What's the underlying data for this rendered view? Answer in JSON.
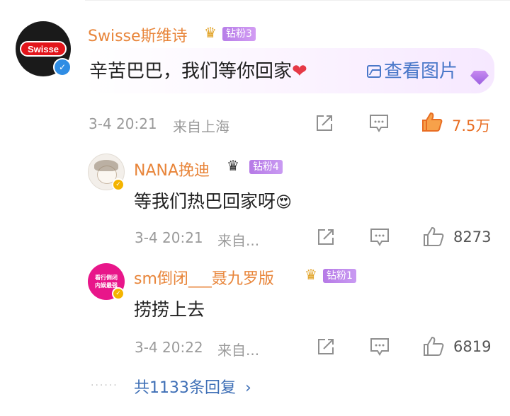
{
  "comment": {
    "user": "Swisse斯维诗",
    "avatar_text": "Swisse",
    "fan_badge": "钻粉3",
    "text": "辛苦巴巴，我们等你回家",
    "heart_icon": "heart-icon",
    "image_link": "查看图片",
    "time": "3-4 20:21",
    "location": "来自上海",
    "likes": "7.5万"
  },
  "replies": [
    {
      "user": "NANA挽迪",
      "fan_badge": "钻粉4",
      "text": "等我们热巴回家呀",
      "emoji": "😍",
      "time": "3-4 20:21",
      "location": "来自...",
      "likes": "8273"
    },
    {
      "user": "sm倒闭___聂九罗版",
      "avatar_text": "看行倒闭 内娱最强",
      "fan_badge": "钻粉1",
      "text": "捞捞上去",
      "time": "3-4 20:22",
      "location": "来自...",
      "likes": "6819"
    }
  ],
  "more_replies": "共1133条回复",
  "colors": {
    "username": "#e8853a",
    "link": "#4a78c9",
    "like_hot": "#e86d22",
    "badge": "#c08cee"
  }
}
